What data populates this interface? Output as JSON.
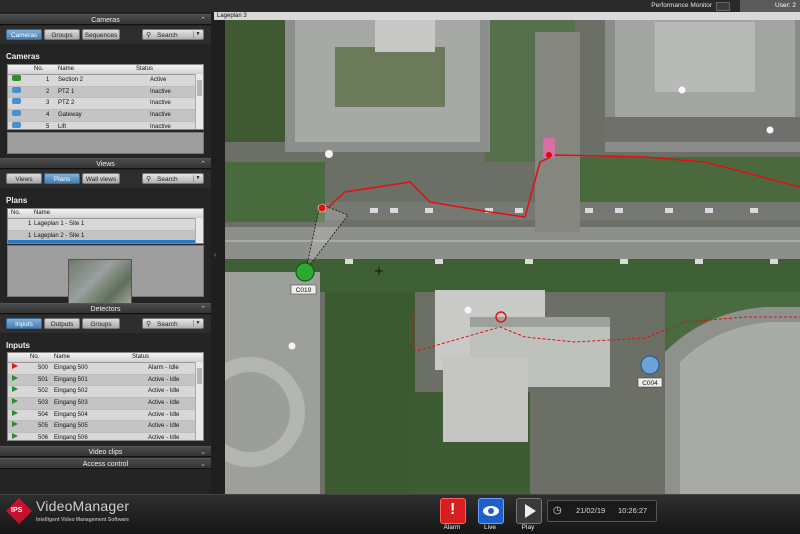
{
  "topbar": {
    "performance_monitor": "Performance Monitor",
    "user": "User: 2"
  },
  "cameras": {
    "header": "Cameras",
    "tabs": [
      "Cameras",
      "Groups",
      "Sequences"
    ],
    "search": "Search",
    "section_title": "Cameras",
    "columns": [
      "No.",
      "Name",
      "Status"
    ],
    "rows": [
      {
        "no": "1",
        "name": "Section 2",
        "status": "Active",
        "icon": "fixed-camera-icon"
      },
      {
        "no": "2",
        "name": "PTZ 1",
        "status": "Inactive",
        "icon": "ptz-camera-icon"
      },
      {
        "no": "3",
        "name": "PTZ 2",
        "status": "Inactive",
        "icon": "ptz-camera-icon"
      },
      {
        "no": "4",
        "name": "Gateway",
        "status": "Inactive",
        "icon": "ptz-camera-icon"
      },
      {
        "no": "5",
        "name": "Lift",
        "status": "Inactive",
        "icon": "ptz-camera-icon"
      }
    ]
  },
  "views": {
    "header": "Views",
    "tabs": [
      "Views",
      "Plans",
      "Wall views"
    ],
    "search": "Search",
    "section_title": "Plans",
    "columns": [
      "No.",
      "Name"
    ],
    "rows": [
      {
        "no": "1",
        "name": "Lageplan 1 - Site 1"
      },
      {
        "no": "1",
        "name": "Lageplan 2 - Site 1"
      }
    ]
  },
  "detectors": {
    "header": "Detectors",
    "tabs": [
      "Inputs",
      "Outputs",
      "Groups"
    ],
    "search": "Search",
    "section_title": "Inputs",
    "columns": [
      "No.",
      "Name",
      "Status"
    ],
    "rows": [
      {
        "no": "500",
        "name": "Eingang 500",
        "status": "Alarm - Idle",
        "alarm": true
      },
      {
        "no": "501",
        "name": "Eingang 501",
        "status": "Active - Idle",
        "alarm": false
      },
      {
        "no": "502",
        "name": "Eingang 502",
        "status": "Active - Idle",
        "alarm": false
      },
      {
        "no": "503",
        "name": "Eingang 503",
        "status": "Active - Idle",
        "alarm": false
      },
      {
        "no": "504",
        "name": "Eingang 504",
        "status": "Active - Idle",
        "alarm": false
      },
      {
        "no": "505",
        "name": "Eingang 505",
        "status": "Active - Idle",
        "alarm": false
      },
      {
        "no": "506",
        "name": "Eingang 506",
        "status": "Active - Idle",
        "alarm": false
      }
    ]
  },
  "video_clips": "Video clips",
  "access_control": "Access control",
  "map": {
    "title": "Lageplan 3",
    "camera_labels": [
      "C019",
      "C004"
    ]
  },
  "footer": {
    "logo_text": "IPS",
    "brand": "VideoManager",
    "tagline": "Intelligent Video Management Software",
    "alarm": "Alarm",
    "live": "Live",
    "play": "Play",
    "date": "21/02/19",
    "time": "10:26:27"
  },
  "colors": {
    "accent": "#4a80b0",
    "alarm": "#e02020",
    "live": "#2c6fd0",
    "route": "#e01010"
  }
}
